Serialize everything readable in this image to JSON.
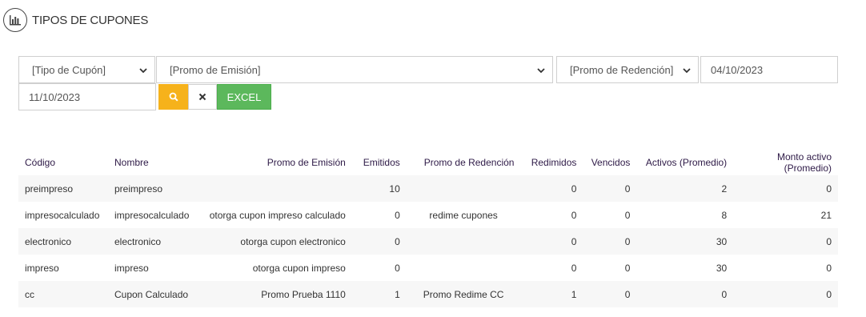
{
  "header": {
    "title": "TIPOS DE CUPONES",
    "icon": "bar-chart-icon"
  },
  "filters": {
    "tipo_cupon": "[Tipo de Cupón]",
    "promo_emision": "[Promo de Emisión]",
    "promo_redencion": "[Promo de Redención]",
    "fecha_desde": "04/10/2023",
    "fecha_hasta": "11/10/2023"
  },
  "buttons": {
    "search_icon": "search-icon",
    "clear_icon": "close-icon",
    "excel_label": "EXCEL",
    "colors": {
      "search": "#f6b21b",
      "excel": "#5cb85c"
    }
  },
  "table": {
    "headers": [
      "Código",
      "Nombre",
      "Promo de Emisión",
      "Emitidos",
      "Promo de Redención",
      "Redimidos",
      "Vencidos",
      "Activos (Promedio)",
      "Monto activo (Promedio)"
    ],
    "rows": [
      [
        "preimpreso",
        "preimpreso",
        "",
        "10",
        "",
        "0",
        "0",
        "2",
        "0"
      ],
      [
        "impresocalculado",
        "impresocalculado",
        "otorga cupon impreso calculado",
        "0",
        "redime cupones",
        "0",
        "0",
        "8",
        "21"
      ],
      [
        "electronico",
        "electronico",
        "otorga cupon electronico",
        "0",
        "",
        "0",
        "0",
        "30",
        "0"
      ],
      [
        "impreso",
        "impreso",
        "otorga cupon impreso",
        "0",
        "",
        "0",
        "0",
        "30",
        "0"
      ],
      [
        "cc",
        "Cupon Calculado",
        "Promo Prueba 1110",
        "1",
        "Promo Redime CC",
        "1",
        "0",
        "0",
        "0"
      ]
    ]
  }
}
